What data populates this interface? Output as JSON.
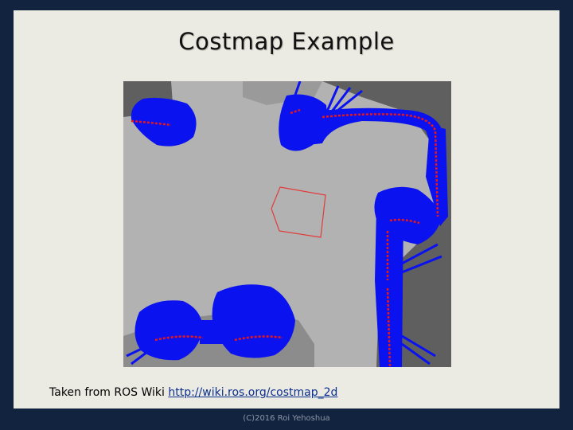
{
  "slide": {
    "title": "Costmap Example",
    "caption_text": "Taken from ROS Wiki ",
    "caption_link": "http://wiki.ros.org/costmap_2d",
    "footer": "(C)2016 Roi Yehoshua"
  },
  "image": {
    "subject": "costmap-visualization",
    "colors": {
      "free_space": "#b2b2b2",
      "unknown_space": "#5f5f5f",
      "inflated_obstacle": "#0a12f0",
      "lethal_obstacle": "#e81818",
      "robot_footprint": "#e23b3b"
    }
  }
}
